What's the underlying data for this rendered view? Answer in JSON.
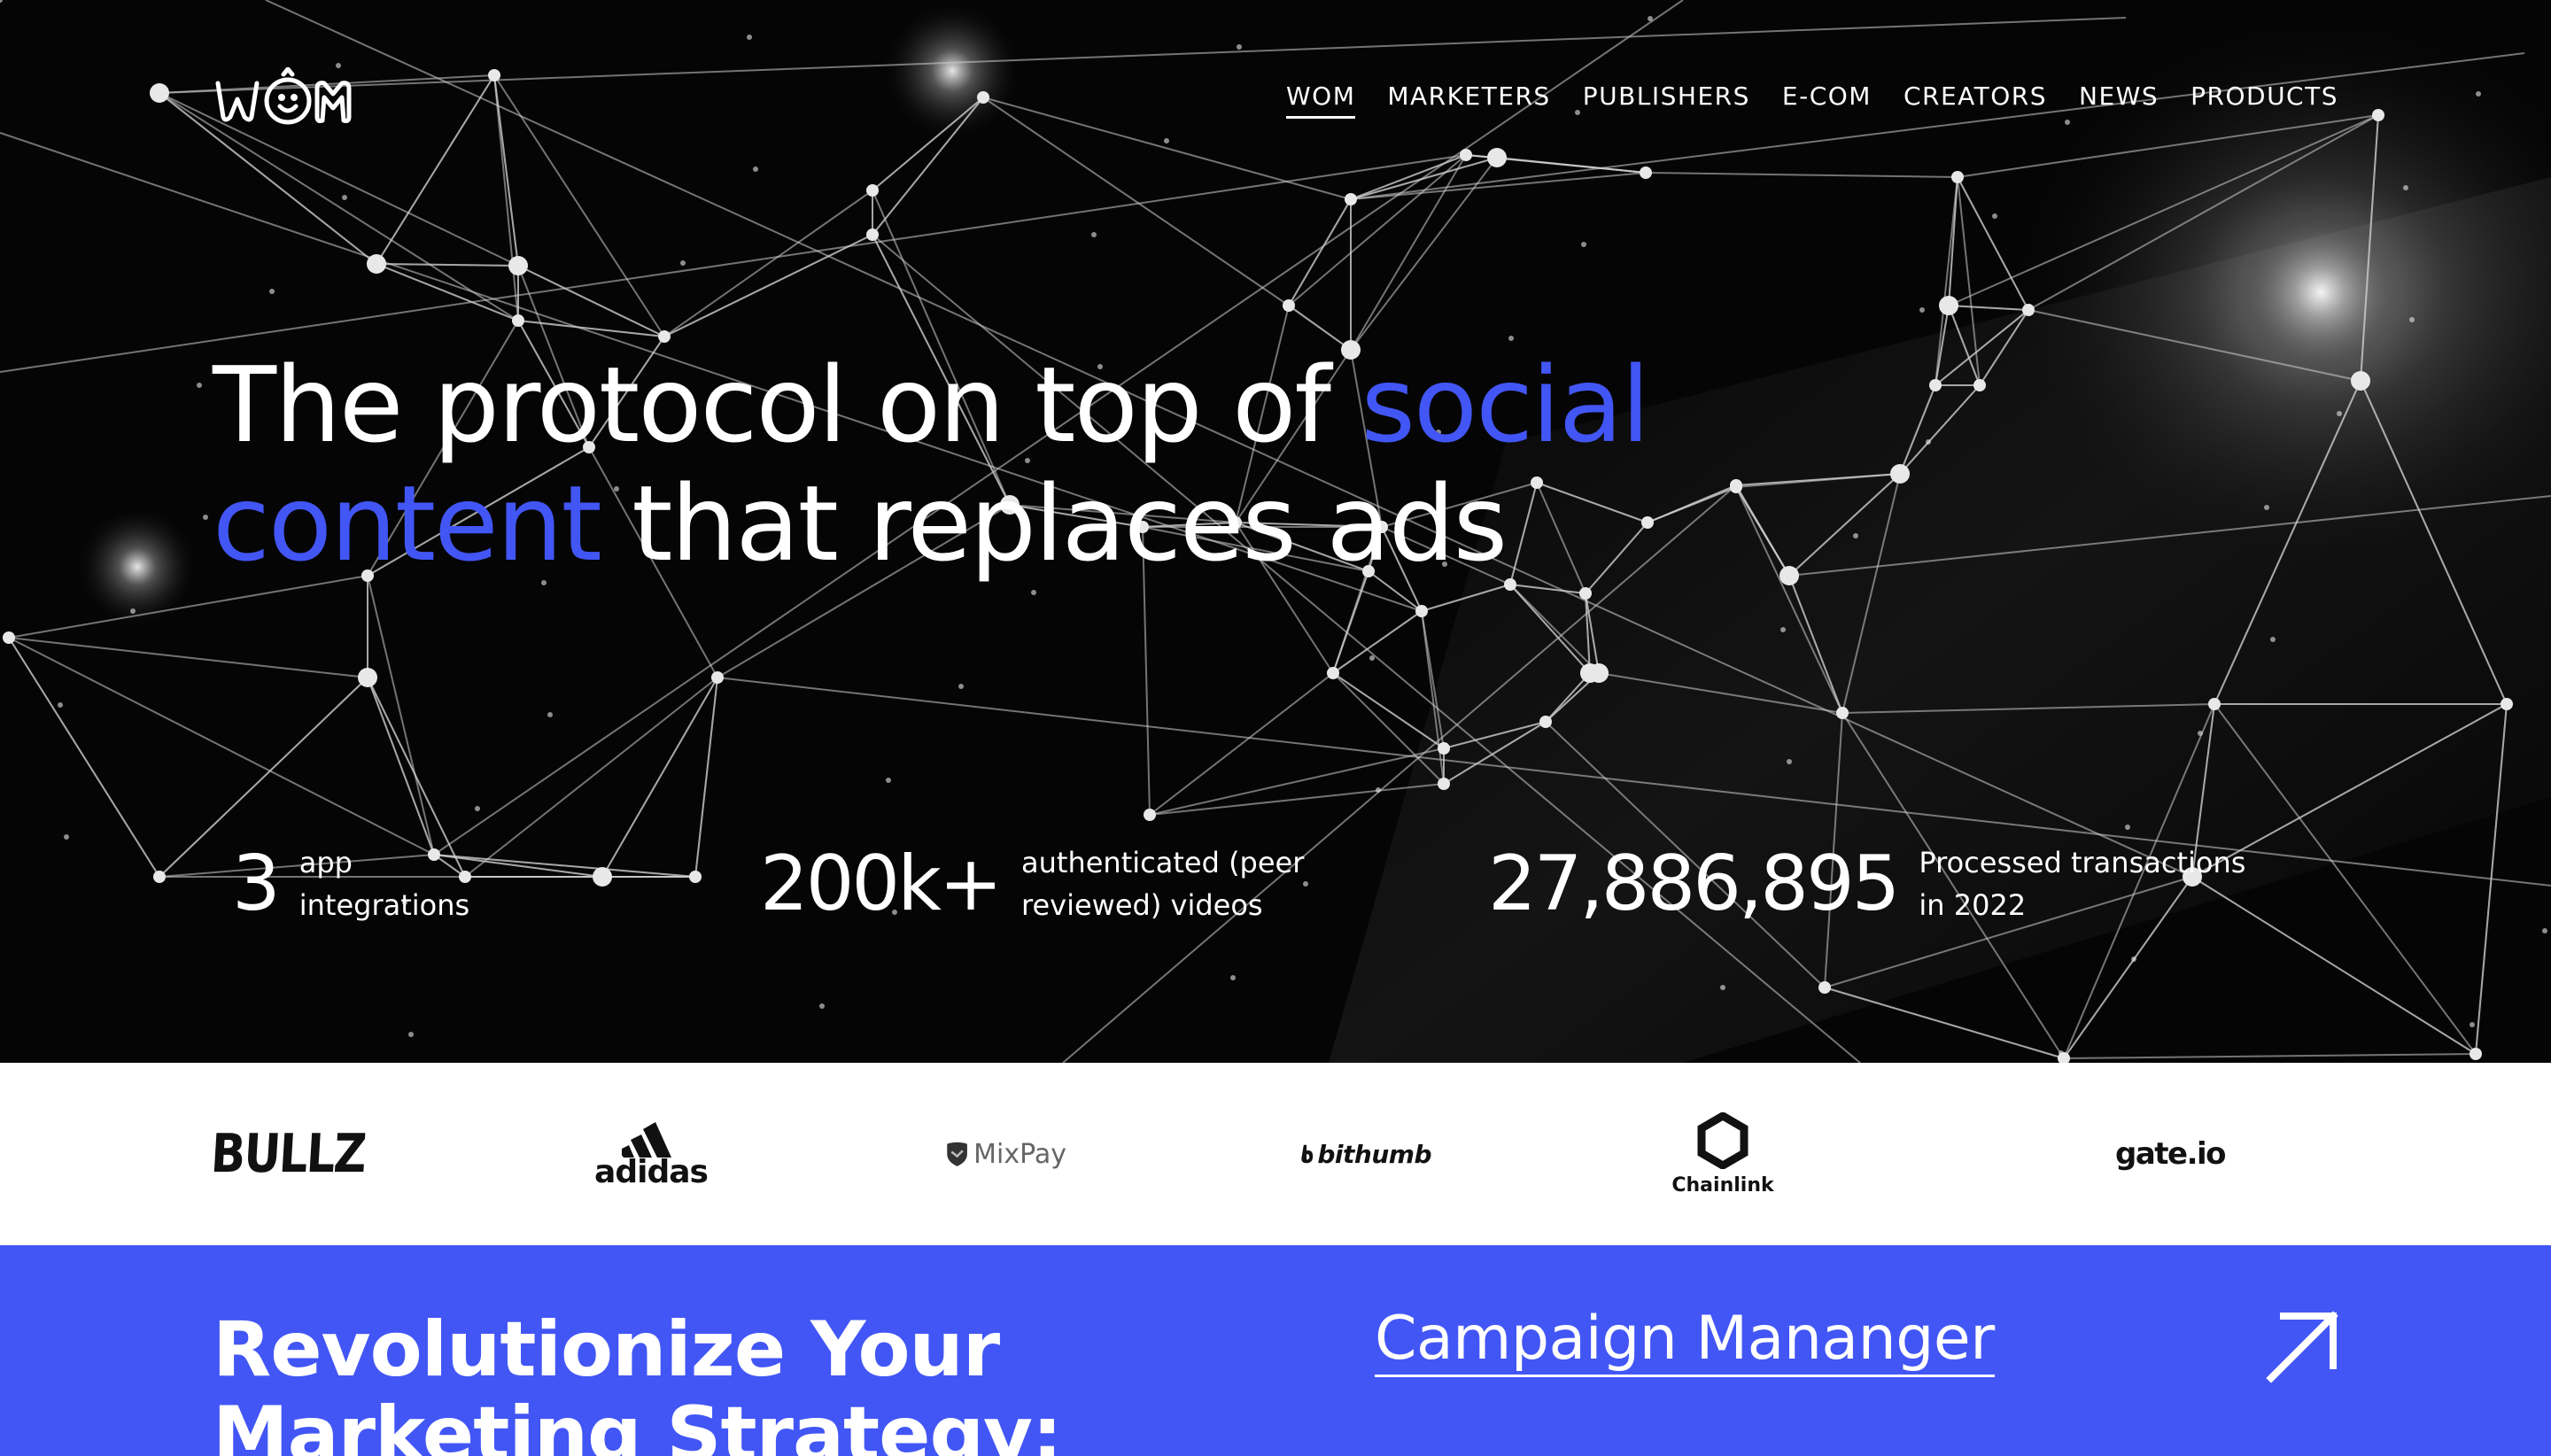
{
  "brand": {
    "logo_text": "WOM"
  },
  "nav": {
    "items": [
      "WOM",
      "MARKETERS",
      "PUBLISHERS",
      "E-COM",
      "CREATORS",
      "NEWS",
      "PRODUCTS"
    ]
  },
  "hero": {
    "headline_part1": "The protocol on top of ",
    "headline_accent1": "social",
    "headline_accent2": "content",
    "headline_part2": " that replaces ads"
  },
  "stats": [
    {
      "value": "3",
      "label_line1": "app",
      "label_line2": "integrations"
    },
    {
      "value": "200k+",
      "label_line1": "authenticated (peer",
      "label_line2": "reviewed) videos"
    },
    {
      "value": "27,886,895",
      "label_line1": "Processed transactions",
      "label_line2": "in 2022"
    }
  ],
  "partners": {
    "bullz": "BULLZ",
    "adidas": "adidas",
    "mixpay": "MixPay",
    "bithumb": "bithumb",
    "chainlink": "Chainlink",
    "gate": "gate.io"
  },
  "cta": {
    "title_line1": "Revolutionize Your",
    "title_line2": "Marketing Strategy:",
    "link_label": "Campaign Mananger"
  },
  "colors": {
    "accent": "#4256f5",
    "hero_bg": "#050505",
    "white": "#ffffff"
  }
}
